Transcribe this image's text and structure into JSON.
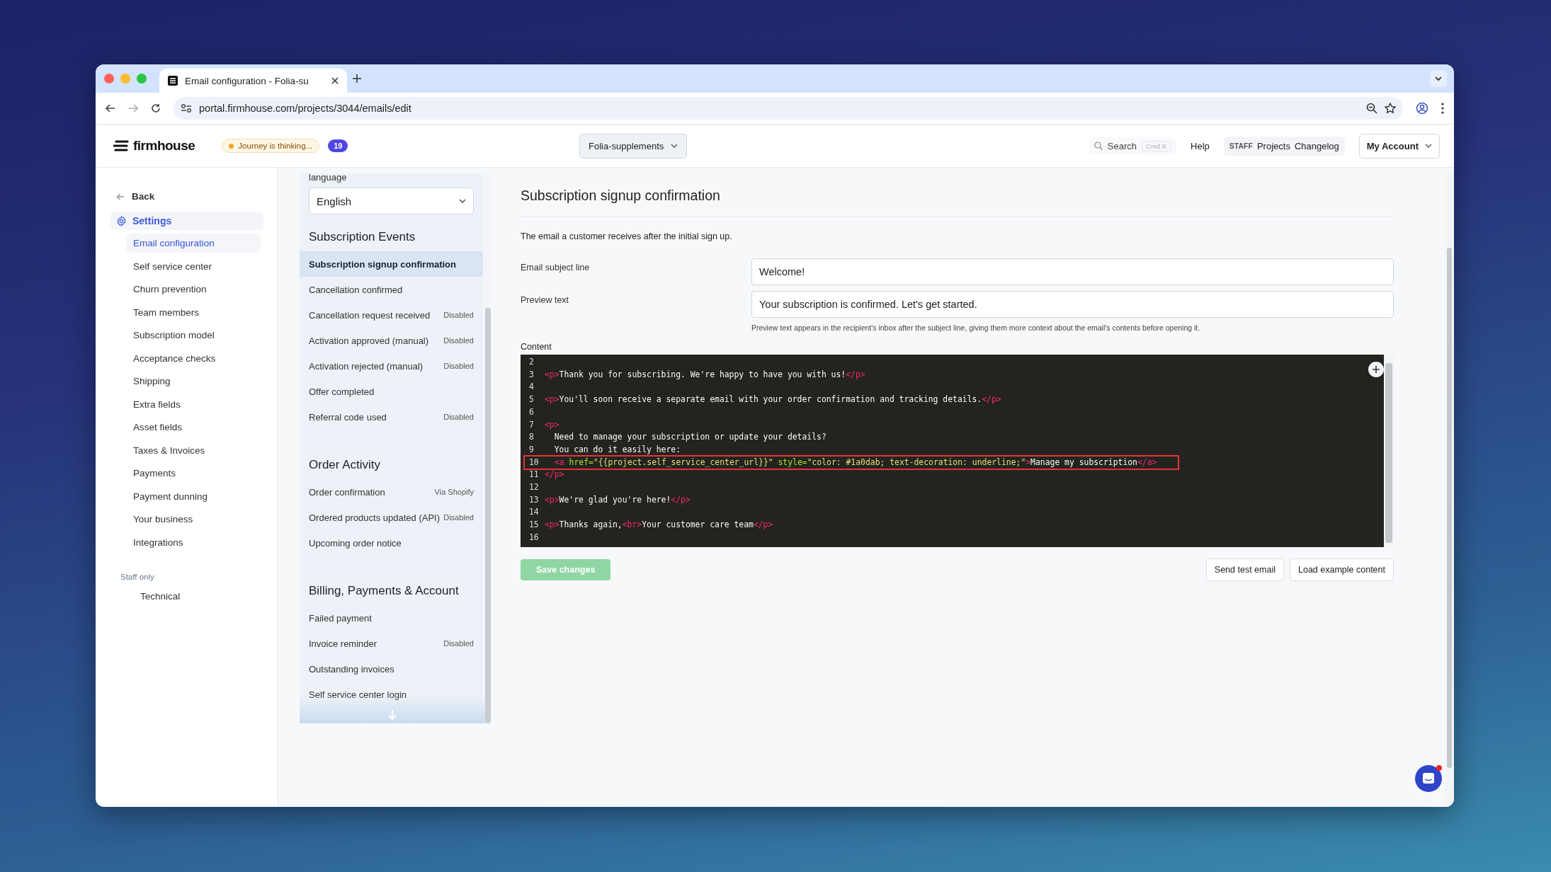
{
  "browser": {
    "tab_title": "Email configuration - Folia-su",
    "url": "portal.firmhouse.com/projects/3044/emails/edit"
  },
  "header": {
    "brand": "firmhouse",
    "status_badge": "Journey is thinking...",
    "count_badge": "19",
    "project": "Folia-supplements",
    "search": {
      "placeholder": "Search",
      "shortcut": "Cmd K"
    },
    "help": "Help",
    "staff": {
      "tag": "STAFF",
      "links": [
        "Projects",
        "Changelog"
      ]
    },
    "account": "My Account"
  },
  "sidebar": {
    "back": "Back",
    "section": {
      "label": "Settings",
      "selected": true
    },
    "items": [
      {
        "label": "Email configuration",
        "selected": true
      },
      {
        "label": "Self service center",
        "selected": false
      },
      {
        "label": "Churn prevention",
        "selected": false
      },
      {
        "label": "Team members",
        "selected": false
      },
      {
        "label": "Subscription model",
        "selected": false
      },
      {
        "label": "Acceptance checks",
        "selected": false
      },
      {
        "label": "Shipping",
        "selected": false
      },
      {
        "label": "Extra fields",
        "selected": false
      },
      {
        "label": "Asset fields",
        "selected": false
      },
      {
        "label": "Taxes & Invoices",
        "selected": false
      },
      {
        "label": "Payments",
        "selected": false
      },
      {
        "label": "Payment dunning",
        "selected": false
      },
      {
        "label": "Your business",
        "selected": false
      },
      {
        "label": "Integrations",
        "selected": false
      }
    ],
    "staff_heading": "Staff only",
    "staff_items": [
      "Technical"
    ]
  },
  "events": {
    "language_label": "language",
    "language": "English",
    "groups": [
      {
        "title": "Subscription Events",
        "items": [
          {
            "label": "Subscription signup confirmation",
            "selected": true
          },
          {
            "label": "Cancellation confirmed",
            "selected": false
          },
          {
            "label": "Cancellation request received",
            "status": "Disabled",
            "selected": false
          },
          {
            "label": "Activation approved (manual)",
            "status": "Disabled",
            "selected": false
          },
          {
            "label": "Activation rejected (manual)",
            "status": "Disabled",
            "selected": false
          },
          {
            "label": "Offer completed",
            "selected": false
          },
          {
            "label": "Referral code used",
            "status": "Disabled",
            "selected": false
          }
        ]
      },
      {
        "title": "Order Activity",
        "items": [
          {
            "label": "Order confirmation",
            "status": "Via Shopify",
            "selected": false
          },
          {
            "label": "Ordered products updated (API)",
            "status": "Disabled",
            "selected": false
          },
          {
            "label": "Upcoming order notice",
            "selected": false
          }
        ]
      },
      {
        "title": "Billing, Payments & Account",
        "items": [
          {
            "label": "Failed payment",
            "selected": false
          },
          {
            "label": "Invoice reminder",
            "status": "Disabled",
            "selected": false
          },
          {
            "label": "Outstanding invoices",
            "selected": false
          },
          {
            "label": "Self service center login",
            "selected": false
          }
        ]
      }
    ]
  },
  "editor": {
    "title": "Subscription signup confirmation",
    "description": "The email a customer receives after the initial sign up.",
    "fields": [
      {
        "label": "Email subject line",
        "value": "Welcome!"
      },
      {
        "label": "Preview text",
        "value": "Your subscription is confirmed. Let's get started.",
        "hint": "Preview text appears in the recipient's inbox after the subject line, giving them more context about the email's contents before opening it."
      }
    ],
    "content_label": "Content",
    "code": [
      {
        "number": "2",
        "highlighted": false
      },
      {
        "number": "3",
        "highlighted": false,
        "tokens": [
          {
            "kind": "tag",
            "text": "<p>"
          },
          {
            "kind": "text",
            "text": "Thank you for subscribing. We're happy to have you with us!"
          },
          {
            "kind": "tag",
            "text": "</p>"
          }
        ]
      },
      {
        "number": "4",
        "highlighted": false
      },
      {
        "number": "5",
        "highlighted": false,
        "tokens": [
          {
            "kind": "tag",
            "text": "<p>"
          },
          {
            "kind": "text",
            "text": "You'll soon receive a separate email with your order confirmation and tracking details."
          },
          {
            "kind": "tag",
            "text": "</p>"
          }
        ]
      },
      {
        "number": "6",
        "highlighted": false
      },
      {
        "number": "7",
        "highlighted": false,
        "tokens": [
          {
            "kind": "tag",
            "text": "<p>"
          }
        ]
      },
      {
        "number": "8",
        "highlighted": false,
        "tokens": [
          {
            "kind": "text",
            "text": "  Need to manage your subscription or update your details?"
          }
        ]
      },
      {
        "number": "9",
        "highlighted": false,
        "tokens": [
          {
            "kind": "text",
            "text": "  You can do it easily here:"
          }
        ]
      },
      {
        "number": "10",
        "highlighted": true,
        "indented": true,
        "tokens": [
          {
            "kind": "tag",
            "text": "<a"
          },
          {
            "kind": "attr",
            "text": " href="
          },
          {
            "kind": "string",
            "text": "\"{{project.self_service_center_url}}\""
          },
          {
            "kind": "attr",
            "text": " style="
          },
          {
            "kind": "string",
            "text": "\"color: #1a0dab; text-decoration: underline;\""
          },
          {
            "kind": "tag",
            "text": ">"
          },
          {
            "kind": "text",
            "text": "Manage my subscription"
          },
          {
            "kind": "tag",
            "text": "</a>"
          }
        ]
      },
      {
        "number": "11",
        "highlighted": false,
        "tokens": [
          {
            "kind": "tag",
            "text": "</p>"
          }
        ]
      },
      {
        "number": "12",
        "highlighted": false
      },
      {
        "number": "13",
        "highlighted": false,
        "tokens": [
          {
            "kind": "tag",
            "text": "<p>"
          },
          {
            "kind": "text",
            "text": "We're glad you're here!"
          },
          {
            "kind": "tag",
            "text": "</p>"
          }
        ]
      },
      {
        "number": "14",
        "highlighted": false
      },
      {
        "number": "15",
        "highlighted": false,
        "tokens": [
          {
            "kind": "tag",
            "text": "<p>"
          },
          {
            "kind": "text",
            "text": "Thanks again,"
          },
          {
            "kind": "tag",
            "text": "<br>"
          },
          {
            "kind": "text",
            "text": "Your customer care team"
          },
          {
            "kind": "tag",
            "text": "</p>"
          }
        ]
      },
      {
        "number": "16",
        "highlighted": false
      }
    ],
    "save_button": "Save changes",
    "actions": [
      "Send test email",
      "Load example content"
    ]
  }
}
